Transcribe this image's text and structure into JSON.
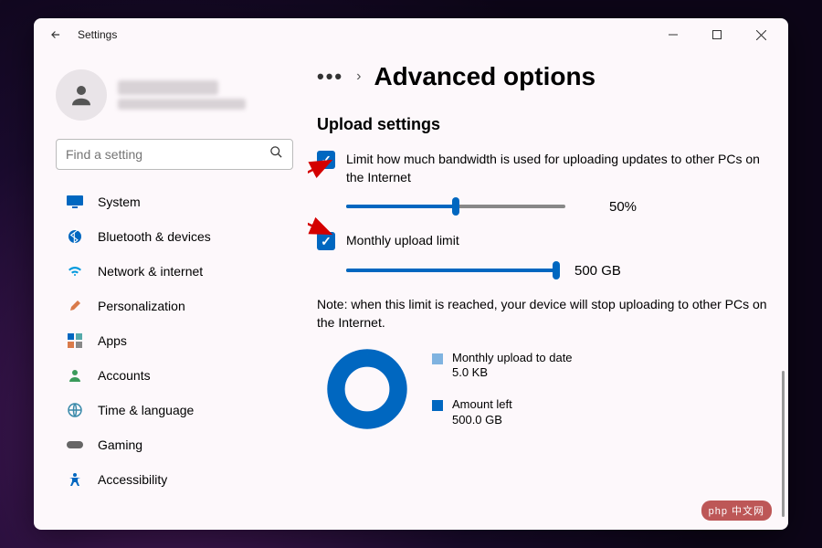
{
  "app": {
    "title": "Settings"
  },
  "window_controls": {
    "min": "minimize",
    "max": "maximize",
    "close": "close"
  },
  "search": {
    "placeholder": "Find a setting"
  },
  "sidebar": {
    "items": [
      {
        "label": "System",
        "icon": "monitor"
      },
      {
        "label": "Bluetooth & devices",
        "icon": "bluetooth"
      },
      {
        "label": "Network & internet",
        "icon": "wifi"
      },
      {
        "label": "Personalization",
        "icon": "brush"
      },
      {
        "label": "Apps",
        "icon": "apps"
      },
      {
        "label": "Accounts",
        "icon": "person"
      },
      {
        "label": "Time & language",
        "icon": "globe"
      },
      {
        "label": "Gaming",
        "icon": "game"
      },
      {
        "label": "Accessibility",
        "icon": "accessibility"
      }
    ]
  },
  "breadcrumb": {
    "page": "Advanced options"
  },
  "section": {
    "heading": "Upload settings"
  },
  "upload": {
    "bandwidth_label": "Limit how much bandwidth is used for uploading updates to other PCs on the Internet",
    "bandwidth_checked": true,
    "bandwidth_pct": 50,
    "bandwidth_pct_label": "50%",
    "monthly_label": "Monthly upload limit",
    "monthly_checked": true,
    "monthly_pct": 100,
    "monthly_val_label": "500 GB",
    "note": "Note: when this limit is reached, your device will stop uploading to other PCs on the Internet."
  },
  "chart_data": {
    "type": "pie",
    "title": "",
    "series": [
      {
        "name": "Monthly upload to date",
        "value_label": "5.0 KB",
        "value_bytes": 5120,
        "color": "#7fb3e0"
      },
      {
        "name": "Amount left",
        "value_label": "500.0 GB",
        "value_bytes": 536870912000,
        "color": "#0067c0"
      }
    ]
  },
  "colors": {
    "accent": "#0067c0"
  },
  "watermark": "php 中文网"
}
